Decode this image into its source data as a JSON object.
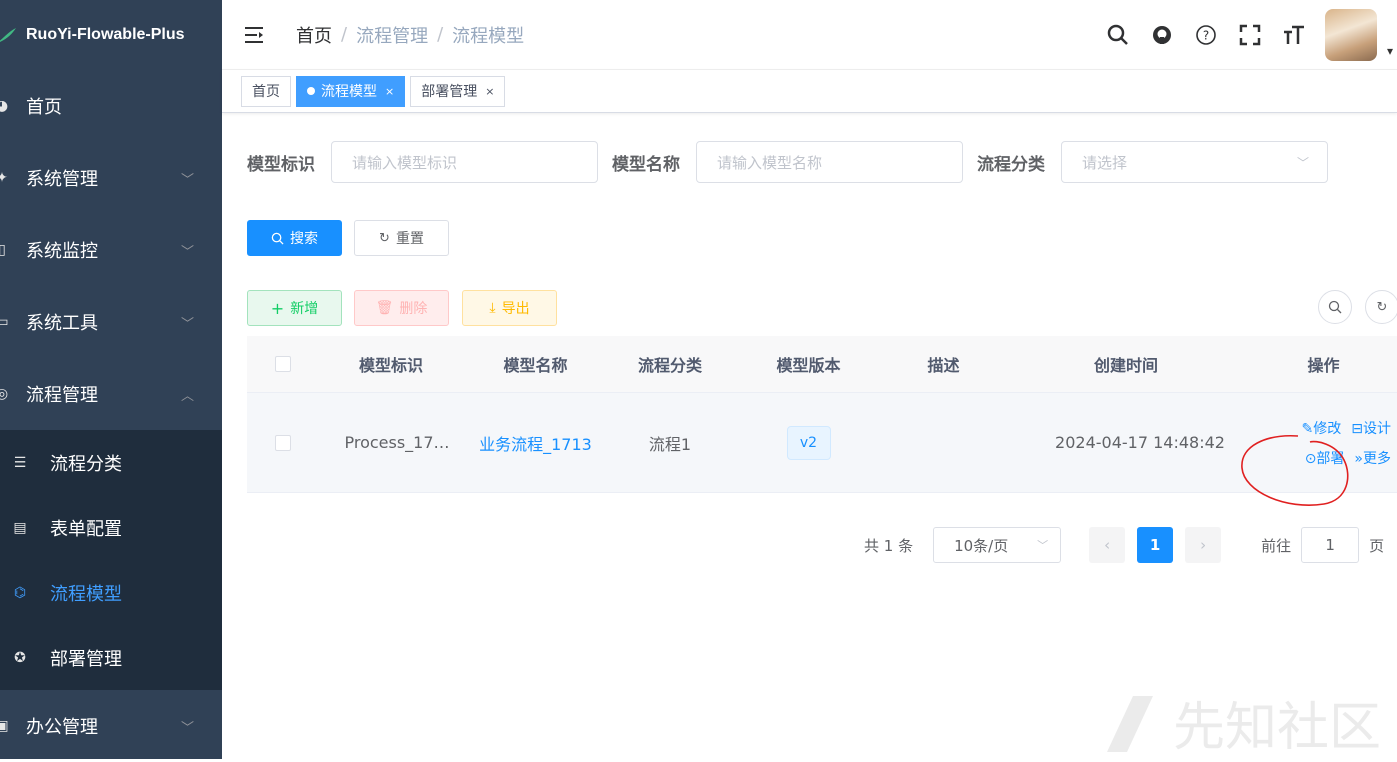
{
  "app": {
    "title": "RuoYi-Flowable-Plus"
  },
  "sidebar": {
    "items": [
      {
        "label": "首页",
        "icon": "dashboard-icon"
      },
      {
        "label": "系统管理",
        "icon": "system-icon",
        "arrow": "﹀"
      },
      {
        "label": "系统监控",
        "icon": "monitor-icon",
        "arrow": "﹀"
      },
      {
        "label": "系统工具",
        "icon": "tool-icon",
        "arrow": "﹀"
      },
      {
        "label": "流程管理",
        "icon": "flow-icon",
        "arrow": "︿"
      }
    ],
    "submenu": [
      {
        "label": "流程分类",
        "icon": "list-icon"
      },
      {
        "label": "表单配置",
        "icon": "form-icon"
      },
      {
        "label": "流程模型",
        "icon": "model-icon",
        "active": true
      },
      {
        "label": "部署管理",
        "icon": "deploy-icon"
      }
    ],
    "bottom": {
      "label": "办公管理",
      "icon": "office-icon",
      "arrow": "﹀"
    }
  },
  "navbar": {
    "breadcrumb": [
      "首页",
      "流程管理",
      "流程模型"
    ],
    "separator": "/"
  },
  "tags": [
    {
      "label": "首页",
      "active": false
    },
    {
      "label": "流程模型",
      "active": true,
      "close": "×"
    },
    {
      "label": "部署管理",
      "active": false,
      "close": "×"
    }
  ],
  "search_form": {
    "model_key_label": "模型标识",
    "model_key_placeholder": "请输入模型标识",
    "model_name_label": "模型名称",
    "model_name_placeholder": "请输入模型名称",
    "category_label": "流程分类",
    "category_placeholder": "请选择",
    "search_button": "搜索",
    "reset_button": "重置"
  },
  "toolbar": {
    "add_button": "新增",
    "delete_button": "删除",
    "export_button": "导出"
  },
  "table": {
    "headers": [
      "模型标识",
      "模型名称",
      "流程分类",
      "模型版本",
      "描述",
      "创建时间",
      "操作"
    ],
    "rows": [
      {
        "model_key": "Process_17…",
        "model_name": "业务流程_1713",
        "category": "流程1",
        "version": "v2",
        "description": "",
        "created_at": "2024-04-17 14:48:42",
        "ops": {
          "edit": "修改",
          "design": "设计",
          "deploy": "部署",
          "more": "更多"
        }
      }
    ]
  },
  "pagination": {
    "total": "共 1 条",
    "page_size": "10条/页",
    "current_page": "1",
    "goto_label": "前往",
    "goto_value": "1",
    "page_suffix": "页",
    "prev": "‹",
    "next": "›"
  },
  "watermark": {
    "text": "先知社区"
  },
  "colors": {
    "sidebar_bg": "#304156",
    "submenu_bg": "#1f2d3d",
    "primary": "#1890ff",
    "success": "#13ce66",
    "danger": "#ff4949",
    "warning": "#ffba00",
    "annotation": "#e02020"
  }
}
